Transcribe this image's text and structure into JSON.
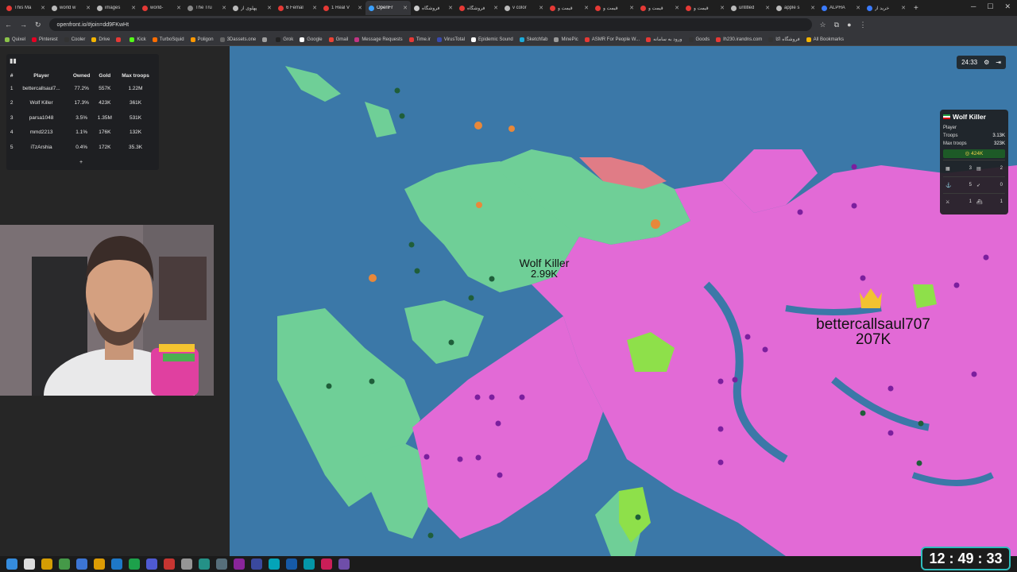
{
  "browser": {
    "tabs": [
      {
        "title": "This Ma",
        "color": "#e53935"
      },
      {
        "title": "world w",
        "color": "#bbbbbb"
      },
      {
        "title": "images",
        "color": "#bbbbbb"
      },
      {
        "title": "world-",
        "color": "#e53935"
      },
      {
        "title": "The Tru",
        "color": "#888888"
      },
      {
        "title": "پهلوی از",
        "color": "#bbbbbb"
      },
      {
        "title": "6 Femal",
        "color": "#e53935"
      },
      {
        "title": "1 Real V",
        "color": "#e53935"
      },
      {
        "title": "OpenFr",
        "color": "#3aa0ff",
        "active": true
      },
      {
        "title": "فروشگاه",
        "color": "#cccccc"
      },
      {
        "title": "فروشگاه",
        "color": "#e53935"
      },
      {
        "title": "v color",
        "color": "#bbbbbb"
      },
      {
        "title": "قیمت و",
        "color": "#e53935"
      },
      {
        "title": "قیمت و",
        "color": "#e53935"
      },
      {
        "title": "قیمت و",
        "color": "#e53935"
      },
      {
        "title": "قیمت و",
        "color": "#e53935"
      },
      {
        "title": "untitled",
        "color": "#bbbbbb"
      },
      {
        "title": "apple s",
        "color": "#bbbbbb"
      },
      {
        "title": "ALPHA",
        "color": "#3a7bff"
      },
      {
        "title": "خرید از",
        "color": "#3a7bff"
      }
    ],
    "url": "openfront.io/#join=dd9FKwHt",
    "bookmarks": [
      {
        "label": "Quixel",
        "color": "#8bc34a"
      },
      {
        "label": "Pinterest",
        "color": "#e60023"
      },
      {
        "label": "Cooler",
        "color": "#333333"
      },
      {
        "label": "Drive",
        "color": "#f4b400"
      },
      {
        "label": "",
        "color": "#e53935"
      },
      {
        "label": "Kick",
        "color": "#53fc18"
      },
      {
        "label": "TurboSquid",
        "color": "#ff6d00"
      },
      {
        "label": "Poligon",
        "color": "#ff9800"
      },
      {
        "label": "3Dassets.one",
        "color": "#666666"
      },
      {
        "label": "",
        "color": "#9e9e9e"
      },
      {
        "label": "Grok",
        "color": "#222222"
      },
      {
        "label": "Google",
        "color": "#ffffff"
      },
      {
        "label": "Gmail",
        "color": "#ea4335"
      },
      {
        "label": "Message Requests",
        "color": "#c13584"
      },
      {
        "label": "Time.ir",
        "color": "#e53935"
      },
      {
        "label": "VirusTotal",
        "color": "#3949ab"
      },
      {
        "label": "Epidemic Sound",
        "color": "#ffffff"
      },
      {
        "label": "Sketchfab",
        "color": "#1caad9"
      },
      {
        "label": "MinePic",
        "color": "#999999"
      },
      {
        "label": "ASMR For People W...",
        "color": "#e53935"
      },
      {
        "label": "ورود به سامانه",
        "color": "#e53935"
      },
      {
        "label": "Goods",
        "color": "#333333"
      },
      {
        "label": "lh230.irandns.com",
        "color": "#e53935"
      },
      {
        "label": "فروشگاه اکا",
        "color": "#333333"
      },
      {
        "label": "All Bookmarks",
        "color": "#f4b400"
      }
    ]
  },
  "leaderboard": {
    "headers": [
      "#",
      "Player",
      "Owned",
      "Gold",
      "Max troops"
    ],
    "rows": [
      {
        "rank": "1",
        "player": "bettercallsaul7...",
        "owned": "77.2%",
        "gold": "557K",
        "troops": "1.22M"
      },
      {
        "rank": "2",
        "player": "Wolf Killer",
        "owned": "17.3%",
        "gold": "423K",
        "troops": "361K"
      },
      {
        "rank": "3",
        "player": "parsa1048",
        "owned": "3.5%",
        "gold": "1.35M",
        "troops": "531K"
      },
      {
        "rank": "4",
        "player": "mmd2213",
        "owned": "1.1%",
        "gold": "176K",
        "troops": "132K"
      },
      {
        "rank": "5",
        "player": "iTzArshia",
        "owned": "0.4%",
        "gold": "172K",
        "troops": "35.3K"
      }
    ],
    "more": "+"
  },
  "game": {
    "timer": "24:33",
    "labels": {
      "wolf_name": "Wolf Killer",
      "wolf_troops": "2.99K",
      "saul_name": "bettercallsaul707",
      "saul_troops": "207K"
    },
    "colors": {
      "water": "#3b78a8",
      "pink": "#e26ad6",
      "green": "#6fcf97",
      "lime": "#8ee04a",
      "salmon": "#e07c86",
      "orange": "#e8883a"
    }
  },
  "infocard": {
    "name": "Wolf Killer",
    "type": "Player",
    "troops_label": "Troops",
    "troops": "3.13K",
    "max_label": "Max troops",
    "max": "323K",
    "gold": "424K",
    "stats": [
      "3",
      "2",
      "5",
      "0",
      "1",
      "1"
    ]
  },
  "clock": {
    "time": "12 : 49 : 33"
  }
}
